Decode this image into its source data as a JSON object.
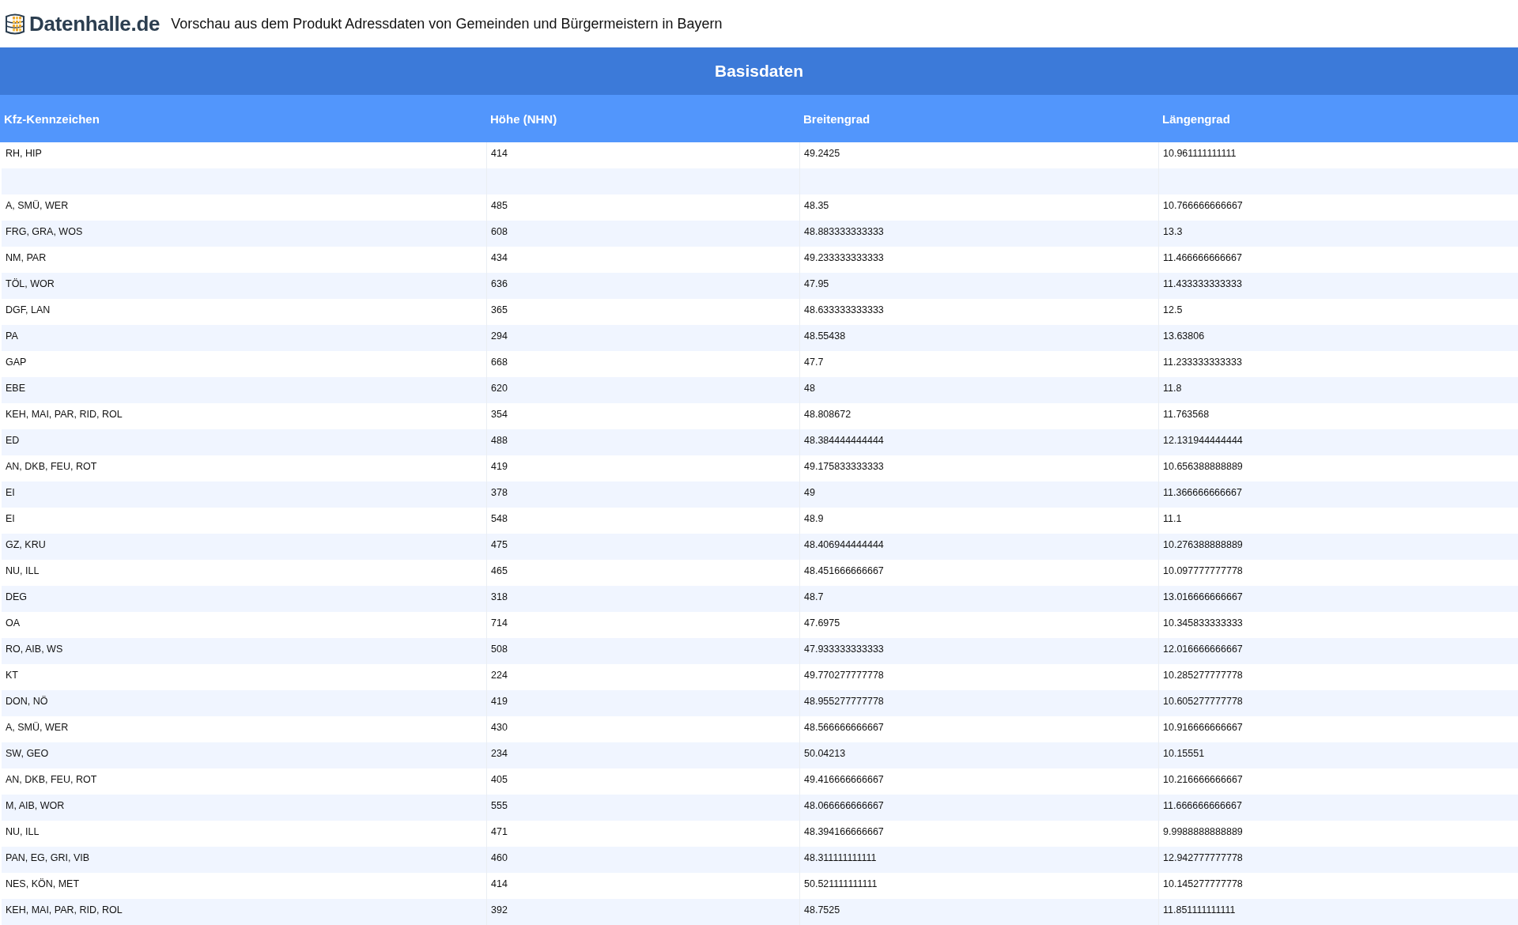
{
  "header": {
    "logo_text": "Datenhalle.de",
    "title": "Vorschau aus dem Produkt Adressdaten von Gemeinden und Bürgermeistern in Bayern"
  },
  "table": {
    "group_title": "Basisdaten",
    "columns": [
      "Kfz-Kennzeichen",
      "Höhe (NHN)",
      "Breitengrad",
      "Längengrad"
    ],
    "rows": [
      {
        "kind": "data",
        "cells": [
          "RH, HIP",
          "414",
          "49.2425",
          "10.961111111111"
        ]
      },
      {
        "kind": "empty"
      },
      {
        "kind": "data",
        "cells": [
          "A, SMÜ, WER",
          "485",
          "48.35",
          "10.766666666667"
        ]
      },
      {
        "kind": "data",
        "cells": [
          "FRG, GRA, WOS",
          "608",
          "48.883333333333",
          "13.3"
        ]
      },
      {
        "kind": "data",
        "cells": [
          "NM, PAR",
          "434",
          "49.233333333333",
          "11.466666666667"
        ]
      },
      {
        "kind": "data",
        "cells": [
          "TÖL, WOR",
          "636",
          "47.95",
          "11.433333333333"
        ]
      },
      {
        "kind": "data",
        "cells": [
          "DGF, LAN",
          "365",
          "48.633333333333",
          "12.5"
        ]
      },
      {
        "kind": "data",
        "cells": [
          "PA",
          "294",
          "48.55438",
          "13.63806"
        ]
      },
      {
        "kind": "data",
        "cells": [
          "GAP",
          "668",
          "47.7",
          "11.233333333333"
        ]
      },
      {
        "kind": "data",
        "cells": [
          "EBE",
          "620",
          "48",
          "11.8"
        ]
      },
      {
        "kind": "data",
        "cells": [
          "KEH, MAI, PAR, RID, ROL",
          "354",
          "48.808672",
          "11.763568"
        ]
      },
      {
        "kind": "data",
        "cells": [
          "ED",
          "488",
          "48.384444444444",
          "12.131944444444"
        ]
      },
      {
        "kind": "data",
        "cells": [
          "AN, DKB, FEU, ROT",
          "419",
          "49.175833333333",
          "10.656388888889"
        ]
      },
      {
        "kind": "data",
        "cells": [
          "EI",
          "378",
          "49",
          "11.366666666667"
        ]
      },
      {
        "kind": "data",
        "cells": [
          "EI",
          "548",
          "48.9",
          "11.1"
        ]
      },
      {
        "kind": "data",
        "cells": [
          "GZ, KRU",
          "475",
          "48.406944444444",
          "10.276388888889"
        ]
      },
      {
        "kind": "data",
        "cells": [
          "NU, ILL",
          "465",
          "48.451666666667",
          "10.097777777778"
        ]
      },
      {
        "kind": "data",
        "cells": [
          "DEG",
          "318",
          "48.7",
          "13.016666666667"
        ]
      },
      {
        "kind": "data",
        "cells": [
          "OA",
          "714",
          "47.6975",
          "10.345833333333"
        ]
      },
      {
        "kind": "data",
        "cells": [
          "RO, AIB, WS",
          "508",
          "47.933333333333",
          "12.016666666667"
        ]
      },
      {
        "kind": "data",
        "cells": [
          "KT",
          "224",
          "49.770277777778",
          "10.285277777778"
        ]
      },
      {
        "kind": "data",
        "cells": [
          "DON, NÖ",
          "419",
          "48.955277777778",
          "10.605277777778"
        ]
      },
      {
        "kind": "data",
        "cells": [
          "A, SMÜ, WER",
          "430",
          "48.566666666667",
          "10.916666666667"
        ]
      },
      {
        "kind": "data",
        "cells": [
          "SW, GEO",
          "234",
          "50.04213",
          "10.15551"
        ]
      },
      {
        "kind": "data",
        "cells": [
          "AN, DKB, FEU, ROT",
          "405",
          "49.416666666667",
          "10.216666666667"
        ]
      },
      {
        "kind": "data",
        "cells": [
          "M, AIB, WOR",
          "555",
          "48.066666666667",
          "11.666666666667"
        ]
      },
      {
        "kind": "data",
        "cells": [
          "NU, ILL",
          "471",
          "48.394166666667",
          "9.9988888888889"
        ]
      },
      {
        "kind": "data",
        "cells": [
          "PAN, EG, GRI, VIB",
          "460",
          "48.311111111111",
          "12.942777777778"
        ]
      },
      {
        "kind": "data",
        "cells": [
          "NES, KÖN, MET",
          "414",
          "50.521111111111",
          "10.145277777778"
        ]
      },
      {
        "kind": "data",
        "cells": [
          "KEH, MAI, PAR, RID, ROL",
          "392",
          "48.7525",
          "11.851111111111"
        ]
      }
    ]
  }
}
